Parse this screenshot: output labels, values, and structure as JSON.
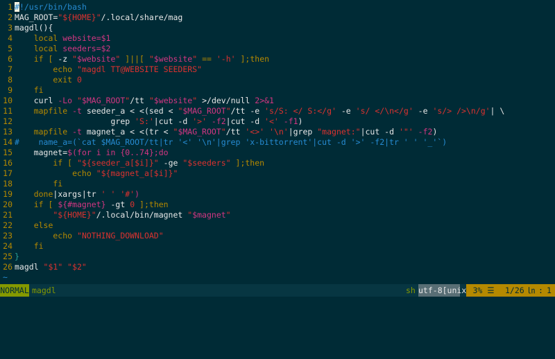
{
  "editor": {
    "cursor_char": "#",
    "lines": [
      {
        "n": "1",
        "segs": [
          [
            "cm",
            "!/usr/bin/bash"
          ]
        ]
      },
      {
        "n": "2",
        "segs": [
          [
            "txt",
            "MAG_ROOT="
          ],
          [
            "str",
            "\"${HOME}\""
          ],
          [
            "txt",
            "/.local/share/mag"
          ]
        ]
      },
      {
        "n": "3",
        "segs": [
          [
            "txt",
            "magdl(){"
          ]
        ]
      },
      {
        "n": "4",
        "segs": [
          [
            "kw",
            "    local "
          ],
          [
            "var",
            "website=$1"
          ]
        ]
      },
      {
        "n": "5",
        "segs": [
          [
            "kw",
            "    local "
          ],
          [
            "var",
            "seeders=$2"
          ]
        ]
      },
      {
        "n": "6",
        "segs": [
          [
            "kw",
            "    if [ "
          ],
          [
            "txt",
            "-z "
          ],
          [
            "str",
            "\""
          ],
          [
            "var",
            "$website"
          ],
          [
            "str",
            "\" "
          ],
          [
            "kw",
            "]||[ "
          ],
          [
            "str",
            "\""
          ],
          [
            "var",
            "$website"
          ],
          [
            "str",
            "\" "
          ],
          [
            "kw",
            "== "
          ],
          [
            "str",
            "'-h' "
          ],
          [
            "kw",
            "];then"
          ]
        ]
      },
      {
        "n": "7",
        "segs": [
          [
            "kw",
            "        echo "
          ],
          [
            "str",
            "\"magdl TT@WEBSITE SEEDERS\""
          ]
        ]
      },
      {
        "n": "8",
        "segs": [
          [
            "kw",
            "        exit "
          ],
          [
            "str",
            "0"
          ]
        ]
      },
      {
        "n": "9",
        "segs": [
          [
            "kw",
            "    fi"
          ]
        ]
      },
      {
        "n": "10",
        "segs": [
          [
            "txt",
            "    curl "
          ],
          [
            "var",
            "-Lo "
          ],
          [
            "str",
            "\""
          ],
          [
            "var",
            "$MAG_ROOT"
          ],
          [
            "str",
            "\""
          ],
          [
            "txt",
            "/tt "
          ],
          [
            "str",
            "\""
          ],
          [
            "var",
            "$website"
          ],
          [
            "str",
            "\" "
          ],
          [
            "txt",
            ">/dev/null "
          ],
          [
            "var",
            "2>&1"
          ]
        ]
      },
      {
        "n": "11",
        "segs": [
          [
            "kw",
            "    mapfile "
          ],
          [
            "var",
            "-t "
          ],
          [
            "txt",
            "seeder_a < <(sed < "
          ],
          [
            "str",
            "\""
          ],
          [
            "var",
            "$MAG_ROOT"
          ],
          [
            "str",
            "\""
          ],
          [
            "txt",
            "/tt -e "
          ],
          [
            "str",
            "'s/S: </ S:</g' "
          ],
          [
            "txt",
            "-e "
          ],
          [
            "str",
            "'s/ </\\n</g' "
          ],
          [
            "txt",
            "-e "
          ],
          [
            "str",
            "'s/> />\\n/g'"
          ],
          [
            "txt",
            "| \\"
          ]
        ]
      },
      {
        "n": "12",
        "segs": [
          [
            "txt",
            "                    grep "
          ],
          [
            "str",
            "'S:'"
          ],
          [
            "txt",
            "|cut -d "
          ],
          [
            "str",
            "'>' "
          ],
          [
            "var",
            "-f2"
          ],
          [
            "txt",
            "|cut -d "
          ],
          [
            "str",
            "'<' "
          ],
          [
            "var",
            "-f1"
          ],
          [
            "txt",
            ")"
          ]
        ]
      },
      {
        "n": "13",
        "segs": [
          [
            "kw",
            "    mapfile "
          ],
          [
            "var",
            "-t "
          ],
          [
            "txt",
            "magnet_a < <(tr < "
          ],
          [
            "str",
            "\""
          ],
          [
            "var",
            "$MAG_ROOT"
          ],
          [
            "str",
            "\""
          ],
          [
            "txt",
            "/tt "
          ],
          [
            "str",
            "'<>' '\\n'"
          ],
          [
            "txt",
            "|grep "
          ],
          [
            "str",
            "\"magnet:\""
          ],
          [
            "txt",
            "|cut -d "
          ],
          [
            "str",
            "'\"' "
          ],
          [
            "var",
            "-f2"
          ],
          [
            "txt",
            ")"
          ]
        ]
      },
      {
        "n": "14",
        "segs": [
          [
            "cm",
            "#    name_a=(`cat $MAG_ROOT/tt|tr '<' '\\n'|grep 'x-bittorrent'|cut -d '>' -f2|tr ' ' '_'`)"
          ]
        ]
      },
      {
        "n": "15",
        "segs": [
          [
            "txt",
            "    magnet="
          ],
          [
            "var",
            "$(for i in {0..74};do"
          ]
        ]
      },
      {
        "n": "16",
        "segs": [
          [
            "kw",
            "        if [ "
          ],
          [
            "str",
            "\"${seeder_a[$i]}\" "
          ],
          [
            "txt",
            "-ge "
          ],
          [
            "str",
            "\"$seeders\" "
          ],
          [
            "kw",
            "];then"
          ]
        ]
      },
      {
        "n": "17",
        "segs": [
          [
            "kw",
            "            echo "
          ],
          [
            "str",
            "\"${magnet_a[$i]}\""
          ]
        ]
      },
      {
        "n": "18",
        "segs": [
          [
            "kw",
            "        fi"
          ]
        ]
      },
      {
        "n": "19",
        "segs": [
          [
            "kw",
            "    done"
          ],
          [
            "txt",
            "|xargs|tr "
          ],
          [
            "str",
            "' ' '#'"
          ],
          [
            "var",
            ")"
          ]
        ]
      },
      {
        "n": "20",
        "segs": [
          [
            "kw",
            "    if [ "
          ],
          [
            "var",
            "${#magnet} "
          ],
          [
            "txt",
            "-gt "
          ],
          [
            "str",
            "0 "
          ],
          [
            "kw",
            "];then"
          ]
        ]
      },
      {
        "n": "21",
        "segs": [
          [
            "str",
            "        \"${HOME}\""
          ],
          [
            "txt",
            "/.local/bin/magnet "
          ],
          [
            "str",
            "\""
          ],
          [
            "var",
            "$magnet"
          ],
          [
            "str",
            "\""
          ]
        ]
      },
      {
        "n": "22",
        "segs": [
          [
            "kw",
            "    else"
          ]
        ]
      },
      {
        "n": "23",
        "segs": [
          [
            "kw",
            "        echo "
          ],
          [
            "str",
            "\"NOTHING_DOWNLOAD\""
          ]
        ]
      },
      {
        "n": "24",
        "segs": [
          [
            "kw",
            "    fi"
          ]
        ]
      },
      {
        "n": "25",
        "segs": [
          [
            "teal",
            "}"
          ]
        ]
      },
      {
        "n": "26",
        "segs": [
          [
            "txt",
            "magdl "
          ],
          [
            "str",
            "\"$1\" \"$2\""
          ]
        ]
      }
    ],
    "tilde": "~"
  },
  "statusline": {
    "mode": "NORMAL",
    "filename": "magdl",
    "filetype": "sh",
    "encoding": "utf-8[unix]",
    "percent": "3% ☰",
    "position_line": "1/26",
    "ln_symbol": "㏑",
    "col_sep": ":",
    "column": "1"
  },
  "colors": {
    "background": "#002b36",
    "comment": "#268bd2",
    "keyword": "#b58900",
    "variable": "#d33682",
    "string": "#dc322f",
    "mode_bg": "#859900"
  }
}
